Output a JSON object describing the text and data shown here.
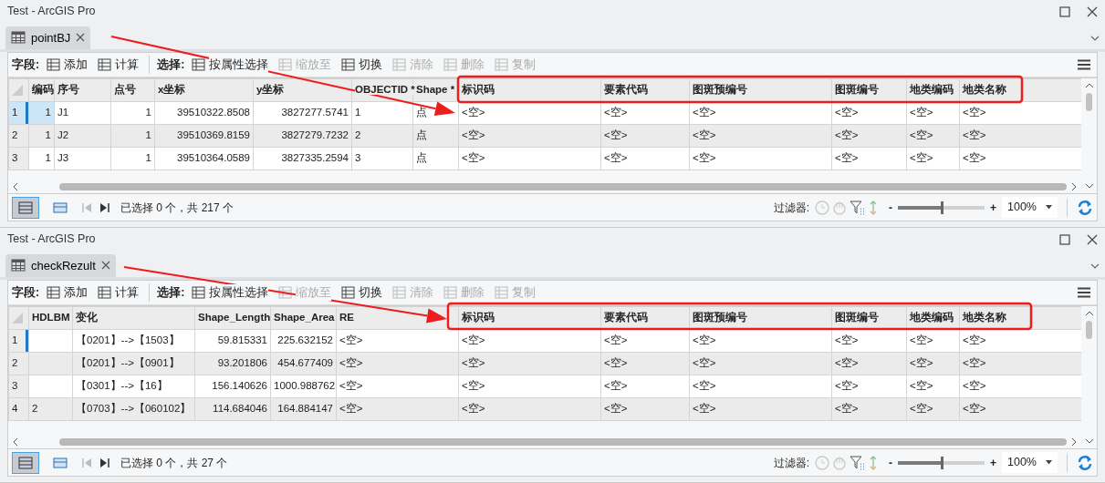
{
  "windows": [
    {
      "title": "Test - ArcGIS Pro",
      "tab": {
        "label": "pointBJ",
        "selected": true
      },
      "toolbar": {
        "groups": [
          {
            "label": "字段:",
            "buttons": [
              {
                "label": "添加",
                "disabled": false
              },
              {
                "label": "计算",
                "disabled": false
              }
            ]
          },
          {
            "label": "选择:",
            "buttons": [
              {
                "label": "按属性选择",
                "disabled": false
              },
              {
                "label": "缩放至",
                "disabled": true
              },
              {
                "label": "切换",
                "disabled": false
              },
              {
                "label": "清除",
                "disabled": true
              },
              {
                "label": "删除",
                "disabled": true
              },
              {
                "label": "复制",
                "disabled": true
              }
            ]
          }
        ]
      },
      "table": {
        "columns": [
          {
            "label": "编码",
            "kind": "number"
          },
          {
            "label": "序号",
            "kind": "text"
          },
          {
            "label": "点号",
            "kind": "number"
          },
          {
            "label": "x坐标",
            "kind": "number"
          },
          {
            "label": "y坐标",
            "kind": "number"
          },
          {
            "label": "OBJECTID *",
            "kind": "text"
          },
          {
            "label": "Shape *",
            "kind": "text"
          },
          {
            "label": "标识码",
            "kind": "text"
          },
          {
            "label": "要素代码",
            "kind": "text"
          },
          {
            "label": "图斑预编号",
            "kind": "text"
          },
          {
            "label": "图斑编号",
            "kind": "text"
          },
          {
            "label": "地类编码",
            "kind": "text"
          },
          {
            "label": "地类名称",
            "kind": "text"
          }
        ],
        "rows": [
          {
            "number": "1",
            "selected": true,
            "current": true,
            "cells": [
              "1",
              "J1",
              "1",
              "39510322.8508",
              "3827277.5741",
              "1",
              "点",
              "<空>",
              "<空>",
              "<空>",
              "<空>",
              "<空>",
              "<空>"
            ]
          },
          {
            "number": "2",
            "selected": false,
            "current": false,
            "cells": [
              "1",
              "J2",
              "1",
              "39510369.8159",
              "3827279.7232",
              "2",
              "点",
              "<空>",
              "<空>",
              "<空>",
              "<空>",
              "<空>",
              "<空>"
            ]
          },
          {
            "number": "3",
            "selected": false,
            "current": false,
            "cells": [
              "1",
              "J3",
              "1",
              "39510364.0589",
              "3827335.2594",
              "3",
              "点",
              "<空>",
              "<空>",
              "<空>",
              "<空>",
              "<空>",
              "<空>"
            ]
          }
        ]
      },
      "status": "已选择 0 个，共 217 个",
      "filter_label": "过滤器:",
      "zoom": {
        "minus": "-",
        "plus": "+",
        "level": 0.52,
        "value": "100%"
      }
    },
    {
      "title": "Test - ArcGIS Pro",
      "tab": {
        "label": "checkRezult",
        "selected": true
      },
      "toolbar": {
        "groups": [
          {
            "label": "字段:",
            "buttons": [
              {
                "label": "添加",
                "disabled": false
              },
              {
                "label": "计算",
                "disabled": false
              }
            ]
          },
          {
            "label": "选择:",
            "buttons": [
              {
                "label": "按属性选择",
                "disabled": false
              },
              {
                "label": "缩放至",
                "disabled": true
              },
              {
                "label": "切换",
                "disabled": false
              },
              {
                "label": "清除",
                "disabled": true
              },
              {
                "label": "删除",
                "disabled": true
              },
              {
                "label": "复制",
                "disabled": true
              }
            ]
          }
        ]
      },
      "table": {
        "columns": [
          {
            "label": "HDLBM",
            "kind": "text"
          },
          {
            "label": "变化",
            "kind": "text"
          },
          {
            "label": "Shape_Length",
            "kind": "number"
          },
          {
            "label": "Shape_Area",
            "kind": "number"
          },
          {
            "label": "RE",
            "kind": "text"
          },
          {
            "label": "标识码",
            "kind": "text"
          },
          {
            "label": "要素代码",
            "kind": "text"
          },
          {
            "label": "图斑预编号",
            "kind": "text"
          },
          {
            "label": "图斑编号",
            "kind": "text"
          },
          {
            "label": "地类编码",
            "kind": "text"
          },
          {
            "label": "地类名称",
            "kind": "text"
          }
        ],
        "rows": [
          {
            "number": "1",
            "selected": false,
            "current": true,
            "cells": [
              "",
              "【0201】-->【1503】",
              "59.815331",
              "225.632152",
              "<空>",
              "<空>",
              "<空>",
              "<空>",
              "<空>",
              "<空>",
              "<空>"
            ]
          },
          {
            "number": "2",
            "selected": false,
            "current": false,
            "cells": [
              "",
              "【0201】-->【0901】",
              "93.201806",
              "454.677409",
              "<空>",
              "<空>",
              "<空>",
              "<空>",
              "<空>",
              "<空>",
              "<空>"
            ]
          },
          {
            "number": "3",
            "selected": false,
            "current": false,
            "cells": [
              "",
              "【0301】-->【16】",
              "156.140626",
              "1000.988762",
              "<空>",
              "<空>",
              "<空>",
              "<空>",
              "<空>",
              "<空>",
              "<空>"
            ]
          },
          {
            "number": "4",
            "selected": false,
            "current": false,
            "cells": [
              "2",
              "【0703】-->【060102】",
              "114.684046",
              "164.884147",
              "<空>",
              "<空>",
              "<空>",
              "<空>",
              "<空>",
              "<空>",
              "<空>"
            ]
          }
        ]
      },
      "status": "已选择 0 个，共 27 个",
      "filter_label": "过滤器:",
      "zoom": {
        "minus": "-",
        "plus": "+",
        "level": 0.52,
        "value": "100%"
      }
    }
  ]
}
